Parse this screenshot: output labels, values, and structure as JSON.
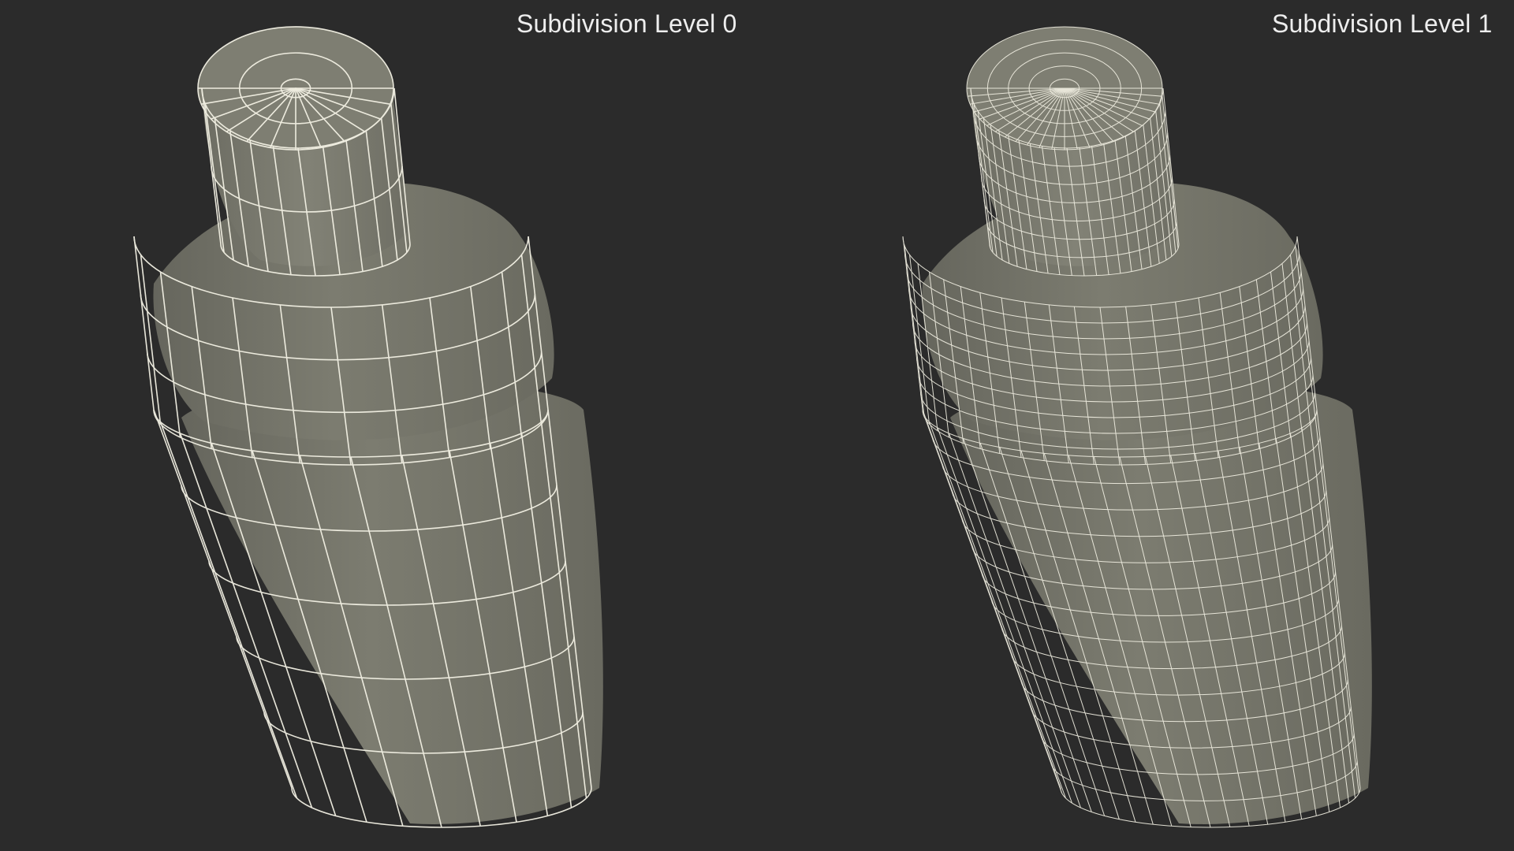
{
  "labels": {
    "left": "Subdivision Level 0",
    "right": "Subdivision Level 1"
  },
  "colors": {
    "background": "#2b2b2b",
    "surface": "#7a7a6e",
    "surface_shade": "#6c6c62",
    "wire": "#f3f1e4"
  },
  "models": [
    {
      "name": "shaker-level-0",
      "rings": 12,
      "segments": 24
    },
    {
      "name": "shaker-level-1",
      "rings": 36,
      "segments": 48
    }
  ]
}
